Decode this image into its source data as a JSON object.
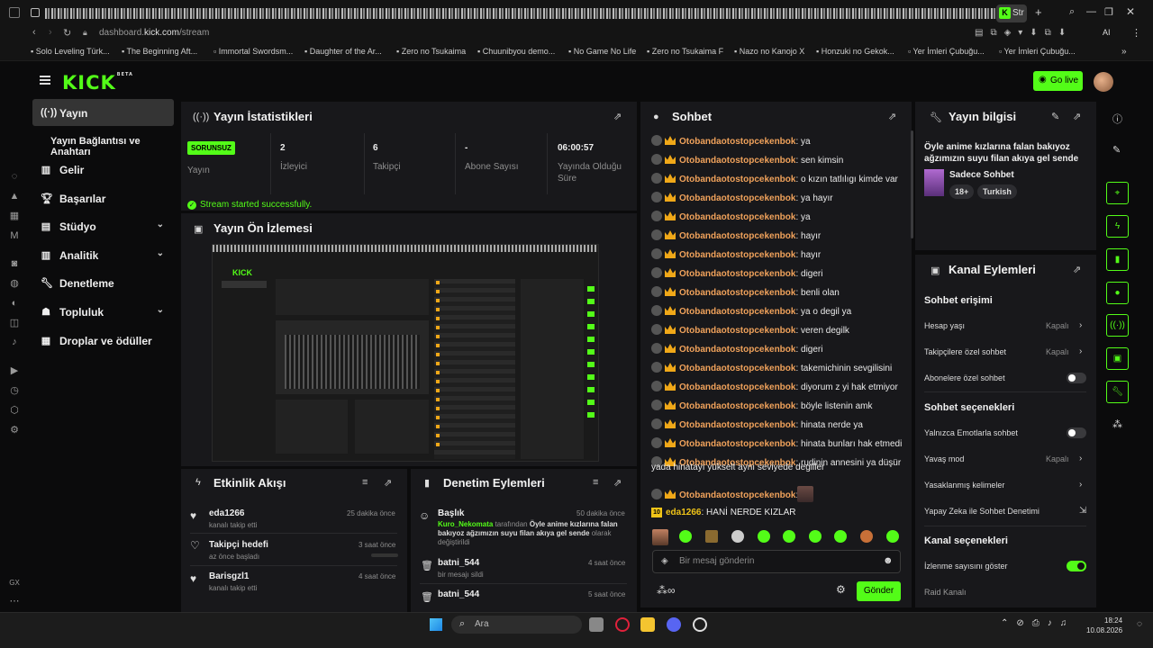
{
  "browser": {
    "active_tab": "Str",
    "url_domain": "dashboard.",
    "url_host": "kick.com",
    "url_path": "/stream",
    "ai_label": "AI",
    "bookmarks": [
      "Solo Leveling Türk...",
      "The Beginning Aft...",
      "Immortal Swordsm...",
      "Daughter of the Ar...",
      "Zero no Tsukaima",
      "Chuunibyou demo...",
      "No Game No Life",
      "Zero no Tsukaima F",
      "Nazo no Kanojo X",
      "Honzuki no Gekok...",
      "Yer İmleri Çubuğu...",
      "Yer İmleri Çubuğu..."
    ]
  },
  "header": {
    "logo": "KICK",
    "logo_sup": "BETA",
    "go_live": "Go live"
  },
  "nav": {
    "items": [
      {
        "label": "Yayın",
        "icon": "broadcast-icon"
      },
      {
        "label": "Yayın Bağlantısı ve Anahtarı",
        "icon": ""
      },
      {
        "label": "Gelir",
        "icon": "chart-icon"
      },
      {
        "label": "Başarılar",
        "icon": "trophy-icon"
      },
      {
        "label": "Stüdyo",
        "icon": "studio-icon"
      },
      {
        "label": "Analitik",
        "icon": "analytics-icon"
      },
      {
        "label": "Denetleme",
        "icon": "wrench-icon"
      },
      {
        "label": "Topluluk",
        "icon": "community-icon"
      },
      {
        "label": "Droplar ve ödüller",
        "icon": "gift-icon"
      }
    ]
  },
  "stats": {
    "title": "Yayın İstatistikleri",
    "status_badge": "SORUNSUZ",
    "status_label": "Yayın",
    "viewers_value": "2",
    "viewers_label": "İzleyici",
    "followers_value": "6",
    "followers_label": "Takipçi",
    "subs_value": "-",
    "subs_label": "Abone Sayısı",
    "uptime_value": "06:00:57",
    "uptime_label": "Yayında Olduğu Süre",
    "success": "Stream started successfully."
  },
  "preview": {
    "title": "Yayın Ön İzlemesi"
  },
  "activity": {
    "title": "Etkinlik Akışı",
    "items": [
      {
        "user": "eda1266",
        "sub": "kanalı takip etti",
        "time": "25 dakika önce"
      },
      {
        "user": "Takipçi hedefi",
        "sub": "az önce başladı",
        "time": "3 saat önce"
      },
      {
        "user": "Barisgzl1",
        "sub": "kanalı takip etti",
        "time": "4 saat önce"
      }
    ]
  },
  "moderation": {
    "title": "Denetim Eylemleri",
    "items": [
      {
        "user": "Başlık",
        "actor": "Kuro_Nekomata",
        "pre": " tarafından ",
        "bold": "Öyle anime kızlarına falan bakıyoz ağzımızın suyu filan akıya gel sende",
        "post": " olarak değiştirildi",
        "time": "50 dakika önce"
      },
      {
        "user": "batni_544",
        "sub": "bir mesajı sildi",
        "time": "4 saat önce"
      },
      {
        "user": "batni_544",
        "sub": "",
        "time": "5 saat önce"
      }
    ]
  },
  "chat": {
    "title": "Sohbet",
    "messages": [
      {
        "user": "Otobandaotostopcekenbok",
        "text": "ya"
      },
      {
        "user": "Otobandaotostopcekenbok",
        "text": "sen kimsin"
      },
      {
        "user": "Otobandaotostopcekenbok",
        "text": "o kızın tatlılıgı kimde var"
      },
      {
        "user": "Otobandaotostopcekenbok",
        "text": "ya hayır"
      },
      {
        "user": "Otobandaotostopcekenbok",
        "text": "ya"
      },
      {
        "user": "Otobandaotostopcekenbok",
        "text": "hayır"
      },
      {
        "user": "Otobandaotostopcekenbok",
        "text": "hayır"
      },
      {
        "user": "Otobandaotostopcekenbok",
        "text": "digeri"
      },
      {
        "user": "Otobandaotostopcekenbok",
        "text": "benli olan"
      },
      {
        "user": "Otobandaotostopcekenbok",
        "text": "ya o degil ya"
      },
      {
        "user": "Otobandaotostopcekenbok",
        "text": "veren degilk"
      },
      {
        "user": "Otobandaotostopcekenbok",
        "text": "digeri"
      },
      {
        "user": "Otobandaotostopcekenbok",
        "text": "takemichinin sevgilisini"
      },
      {
        "user": "Otobandaotostopcekenbok",
        "text": "diyorum z yi hak etmiyor"
      },
      {
        "user": "Otobandaotostopcekenbok",
        "text": "böyle listenin amk"
      },
      {
        "user": "Otobandaotostopcekenbok",
        "text": "hinata nerde ya"
      },
      {
        "user": "Otobandaotostopcekenbok",
        "text": "hinata bunları hak etmedi"
      },
      {
        "user": "Otobandaotostopcekenbok",
        "text": "rudinin annesini ya düşür"
      }
    ],
    "wrap_line": "yada hinatayı yükselt aynı seviyede degiller",
    "emote_msg_user": "Otobandaotostopcekenbok",
    "last_user": "eda1266",
    "last_badge": "10",
    "last_text": "HANİ NERDE KIZLAR",
    "input_placeholder": "Bir mesaj gönderin",
    "send": "Gönder"
  },
  "stream_info": {
    "title": "Yayın bilgisi",
    "text": "Öyle anime kızlarına falan bakıyoz ağzımızın suyu filan akıya gel sende",
    "category": "Sadece Sohbet",
    "tag1": "18+",
    "tag2": "Turkish"
  },
  "channel_actions": {
    "title": "Kanal Eylemleri",
    "chat_access": "Sohbet erişimi",
    "account_age": "Hesap yaşı",
    "account_age_val": "Kapalı",
    "followers_only": "Takipçilere özel sohbet",
    "followers_only_val": "Kapalı",
    "subs_only": "Abonelere özel sohbet",
    "chat_options": "Sohbet seçenekleri",
    "emotes_only": "Yalnızca Emotlarla sohbet",
    "slow_mode": "Yavaş mod",
    "slow_mode_val": "Kapalı",
    "banned_words": "Yasaklanmış kelimeler",
    "ai_mod": "Yapay Zeka ile Sohbet Denetimi",
    "channel_options": "Kanal seçenekleri",
    "show_viewers": "İzlenme sayısını göster",
    "raid": "Raid Kanalı"
  },
  "taskbar": {
    "search": "Ara",
    "time": "18:24",
    "date": "10.08.2026"
  },
  "colors": {
    "accent": "#53fc18",
    "username": "#f0a25b",
    "panel": "#18181b"
  }
}
